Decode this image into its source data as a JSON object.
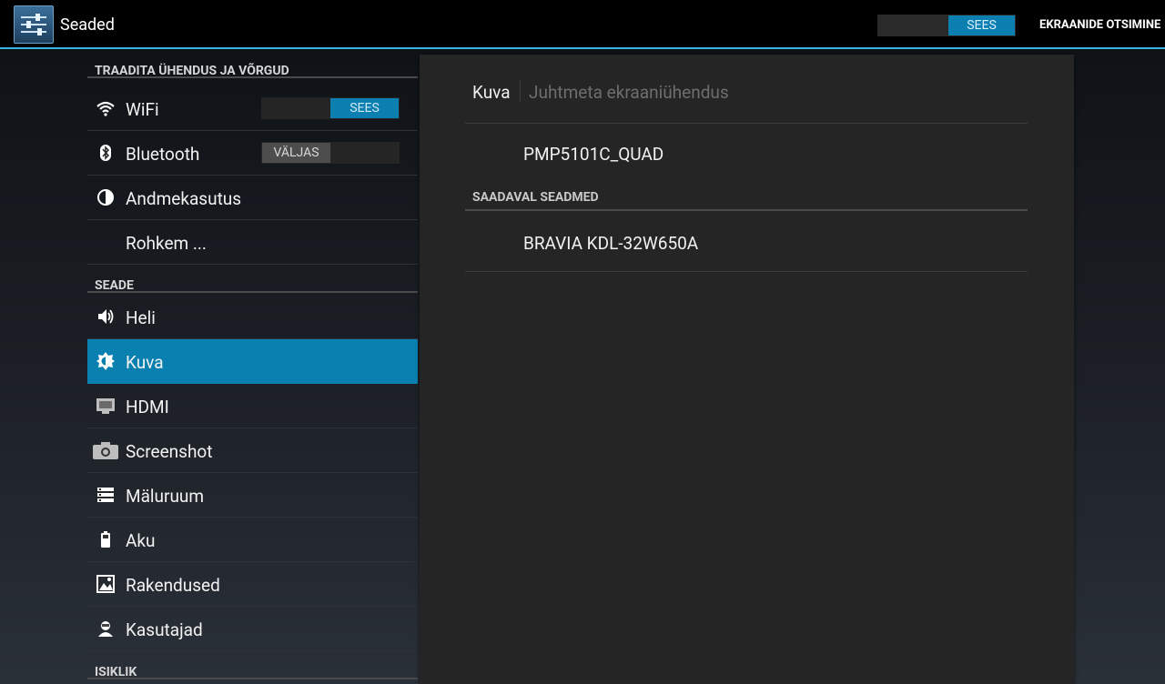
{
  "actionbar": {
    "title": "Seaded",
    "master_switch": "SEES",
    "scan_label": "EKRAANIDE OTSIMINE"
  },
  "sidebar": {
    "sections": [
      "TRAADITA ÜHENDUS JA VÕRGUD",
      "SEADE",
      "ISIKLIK"
    ],
    "wifi": {
      "label": "WiFi",
      "switch": "SEES",
      "icon": "wifi-icon"
    },
    "bluetooth": {
      "label": "Bluetooth",
      "switch": "VÄLJAS",
      "icon": "bluetooth-icon"
    },
    "data_usage": {
      "label": "Andmekasutus",
      "icon": "data-usage-icon"
    },
    "more": {
      "label": "Rohkem ..."
    },
    "sound": {
      "label": "Heli",
      "icon": "speaker-icon"
    },
    "display": {
      "label": "Kuva",
      "icon": "brightness-icon",
      "selected": true
    },
    "hdmi": {
      "label": "HDMI",
      "icon": "hdmi-icon"
    },
    "screenshot": {
      "label": "Screenshot",
      "icon": "camera-icon"
    },
    "storage": {
      "label": "Mäluruum",
      "icon": "storage-icon"
    },
    "battery": {
      "label": "Aku",
      "icon": "battery-icon"
    },
    "apps": {
      "label": "Rakendused",
      "icon": "apps-icon"
    },
    "users": {
      "label": "Kasutajad",
      "icon": "user-icon"
    }
  },
  "main": {
    "breadcrumb_current": "Kuva",
    "breadcrumb_sub": "Juhtmeta ekraaniühendus",
    "own_device": "PMP5101C_QUAD",
    "available_header": "SAADAVAL SEADMED",
    "available_devices": [
      "BRAVIA KDL-32W650A"
    ]
  },
  "colors": {
    "accent": "#33b5e5",
    "selected": "#0a80b0"
  }
}
